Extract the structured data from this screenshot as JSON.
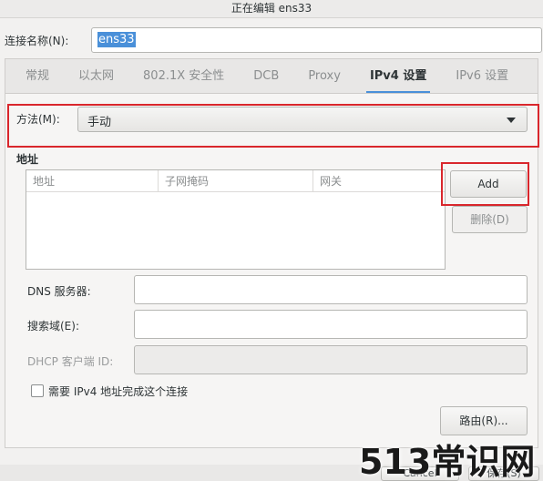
{
  "window": {
    "title": "正在编辑 ens33"
  },
  "connection": {
    "label": "连接名称(N):",
    "value": "ens33"
  },
  "tabs": [
    {
      "label": "常规"
    },
    {
      "label": "以太网"
    },
    {
      "label": "802.1X 安全性"
    },
    {
      "label": "DCB"
    },
    {
      "label": "Proxy"
    },
    {
      "label": "IPv4 设置"
    },
    {
      "label": "IPv6 设置"
    }
  ],
  "method": {
    "label": "方法(M):",
    "value": "手动"
  },
  "addresses": {
    "title": "地址",
    "columns": [
      "地址",
      "子网掩码",
      "网关"
    ],
    "add_label": "Add",
    "delete_label": "删除(D)"
  },
  "dns": {
    "label": "DNS 服务器:",
    "value": ""
  },
  "search": {
    "label": "搜索域(E):",
    "value": ""
  },
  "dhcp": {
    "label": "DHCP 客户端 ID:",
    "value": ""
  },
  "require_ipv4": {
    "label": "需要 IPv4 地址完成这个连接",
    "checked": false
  },
  "routes": {
    "label": "路由(R)..."
  },
  "footer": {
    "cancel_label": "Cancel",
    "save_label": "保存(S)"
  },
  "watermark": {
    "text": "513常识网"
  },
  "colors": {
    "accent": "#4a90d9",
    "highlight_box": "#d9262c"
  }
}
